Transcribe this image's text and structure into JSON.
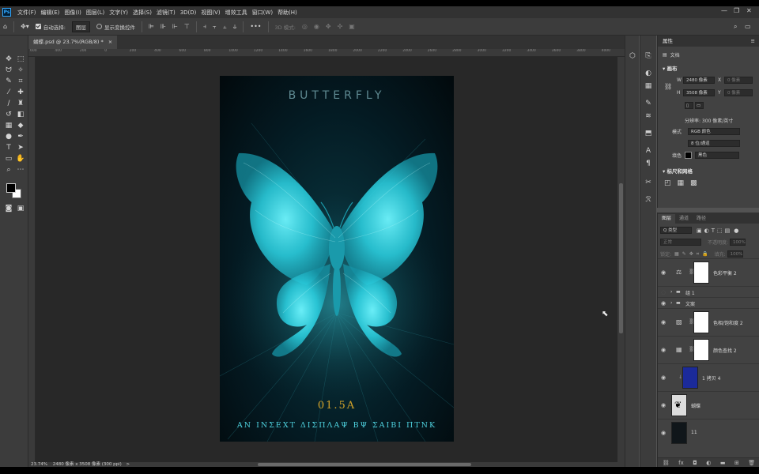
{
  "menu": {
    "app_badge": "Ps",
    "items": [
      "文件(F)",
      "编辑(E)",
      "图像(I)",
      "图层(L)",
      "文字(Y)",
      "选择(S)",
      "滤镜(T)",
      "3D(D)",
      "视图(V)",
      "增效工具",
      "窗口(W)",
      "帮助(H)"
    ]
  },
  "window_controls": {
    "minimize": "—",
    "restore": "❐",
    "close": "✕"
  },
  "options": {
    "auto_select_label": "自动选择:",
    "auto_select_target": "图层",
    "show_transform_label": "显示变换控件",
    "mode_3d_label": "3D 模式:",
    "more": "•••"
  },
  "document": {
    "tab_title": "蝴蝶.psd @ 23.7%(RGB/8) *",
    "tab_close": "×"
  },
  "ruler": {
    "h_labels": [
      "600",
      "400",
      "200",
      "0",
      "200",
      "400",
      "600",
      "800",
      "1000",
      "1200",
      "1400",
      "1600",
      "1800",
      "2000",
      "2200",
      "2400",
      "2600",
      "2800",
      "3000",
      "3200",
      "3400",
      "3600",
      "3800",
      "4000"
    ]
  },
  "poster": {
    "title": "BUTTERFLY",
    "code": "01.5A",
    "subtitle": "AN INΣEXT ΔIΣΠΛΑΨ BΨ ΣAIBI ΠΤΝΚ"
  },
  "status": {
    "zoom": "23.74%",
    "doc_size": "2480 像素 x 3508 像素 (300 ppi)",
    "arrow": ">"
  },
  "properties": {
    "tab": "属性",
    "doc_label": "文档",
    "canvas_title": "画布",
    "w_label": "W",
    "w_value": "2480 像素",
    "x_label": "X",
    "x_value": "0 像素",
    "h_label": "H",
    "h_value": "3508 像素",
    "y_label": "Y",
    "y_value": "0 像素",
    "resolution": "分辨率: 300 像素/英寸",
    "mode_label": "模式",
    "mode_value": "RGB 颜色",
    "depth_value": "8 位/通道",
    "fill_label": "填色",
    "fill_value": "黑色",
    "rulers_title": "标尺和网格"
  },
  "layers": {
    "tabs": [
      "图层",
      "通道",
      "路径"
    ],
    "filter_kind": "Q 类型",
    "blend_mode": "正常",
    "opacity_label": "不透明度:",
    "opacity_value": "100%",
    "lock_label": "锁定:",
    "fill_label": "填充:",
    "fill_value": "100%",
    "items": [
      {
        "name": "色彩平衡 2"
      },
      {
        "name": "组 1"
      },
      {
        "name": "文案"
      },
      {
        "name": "色相/饱和度 2"
      },
      {
        "name": "颜色查找 2"
      },
      {
        "name": "1 拷贝 4"
      },
      {
        "name": "蝴蝶"
      },
      {
        "name": "11"
      }
    ]
  },
  "colors": {
    "accent": "#31a8ff",
    "poster_cyan": "#4fd3e0",
    "poster_gold": "#d6a52a"
  }
}
